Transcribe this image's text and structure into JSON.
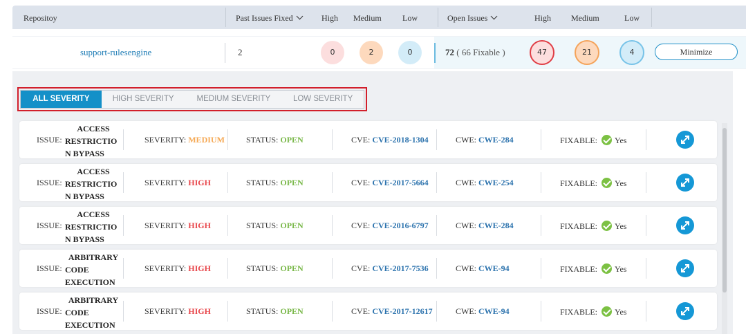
{
  "header": {
    "repository": "Repositoy",
    "past_fixed": "Past Issues Fixed",
    "past_high": "High",
    "past_medium": "Medium",
    "past_low": "Low",
    "open_issues": "Open Issues",
    "open_high": "High",
    "open_medium": "Medium",
    "open_low": "Low"
  },
  "repo": {
    "name": "support-rulesengine",
    "past_fixed": "2",
    "past_high": "0",
    "past_medium": "2",
    "past_low": "0",
    "open_count": "72",
    "open_fixable": "( 66 Fixable )",
    "open_high": "47",
    "open_medium": "21",
    "open_low": "4",
    "minimize_label": "Minimize"
  },
  "tabs": [
    {
      "label": "ALL SEVERITY",
      "active": true
    },
    {
      "label": "HIGH SEVERITY",
      "active": false
    },
    {
      "label": "MEDIUM SEVERITY",
      "active": false
    },
    {
      "label": "LOW SEVERITY",
      "active": false
    }
  ],
  "labels": {
    "issue": "ISSUE:",
    "severity": "SEVERITY:",
    "status": "STATUS:",
    "cve": "CVE:",
    "cwe": "CWE:",
    "fixable": "FIXABLE:"
  },
  "issues": [
    {
      "line1": "ACCESS",
      "line2": "RESTRICTIO",
      "line3": "N BYPASS",
      "severity": "MEDIUM",
      "status": "OPEN",
      "cve": "CVE-2018-1304",
      "cwe": "CWE-284",
      "fixable": "Yes"
    },
    {
      "line1": "ACCESS",
      "line2": "RESTRICTIO",
      "line3": "N BYPASS",
      "severity": "HIGH",
      "status": "OPEN",
      "cve": "CVE-2017-5664",
      "cwe": "CWE-254",
      "fixable": "Yes"
    },
    {
      "line1": "ACCESS",
      "line2": "RESTRICTIO",
      "line3": "N BYPASS",
      "severity": "HIGH",
      "status": "OPEN",
      "cve": "CVE-2016-6797",
      "cwe": "CWE-284",
      "fixable": "Yes"
    },
    {
      "line1": "ARBITRARY",
      "line2": "CODE",
      "line3": "EXECUTION",
      "severity": "HIGH",
      "status": "OPEN",
      "cve": "CVE-2017-7536",
      "cwe": "CWE-94",
      "fixable": "Yes"
    },
    {
      "line1": "ARBITRARY",
      "line2": "CODE",
      "line3": "EXECUTION",
      "severity": "HIGH",
      "status": "OPEN",
      "cve": "CVE-2017-12617",
      "cwe": "CWE-94",
      "fixable": "Yes"
    }
  ],
  "colors": {
    "accent": "#1490c8",
    "high": "#e8454a",
    "medium": "#f5a955",
    "open": "#7ab84a",
    "link": "#2b72ad",
    "highlight_border": "#d21f2b"
  },
  "icons": {
    "sort": "chevron-down-icon",
    "fixable": "check-circle-icon",
    "expand": "expand-arrows-icon"
  }
}
